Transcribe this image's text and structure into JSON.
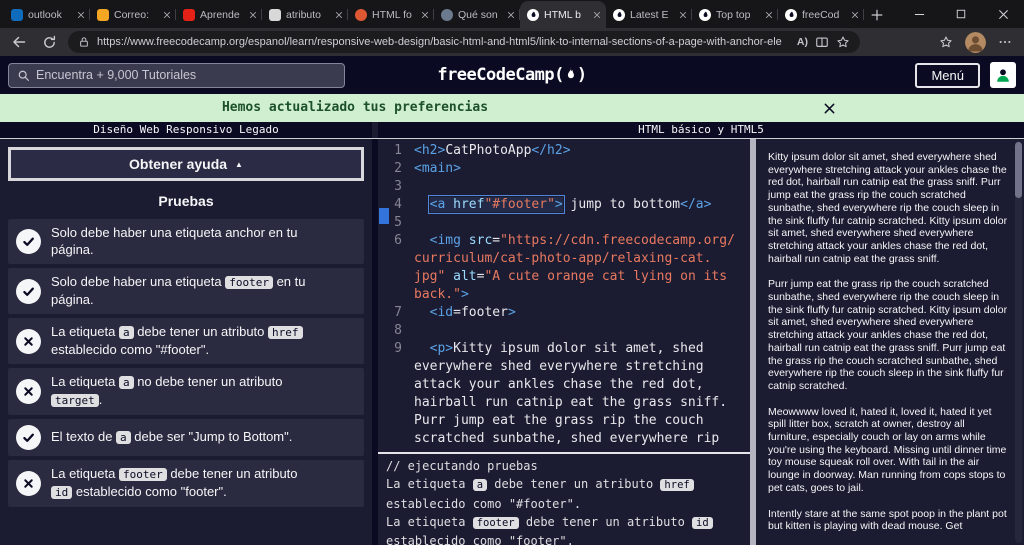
{
  "browser": {
    "tabs": [
      {
        "label": "outlook",
        "icon": "outlook",
        "color": "#0f6cbd",
        "shape": "square",
        "active": false
      },
      {
        "label": "Correo:",
        "icon": "mail",
        "color": "#f5a623",
        "shape": "square",
        "active": false
      },
      {
        "label": "Aprende",
        "icon": "video",
        "color": "#e62117",
        "shape": "square",
        "active": false
      },
      {
        "label": "atributo",
        "icon": "page",
        "color": "#d8d8d8",
        "shape": "square",
        "active": false
      },
      {
        "label": "HTML fo",
        "icon": "duckduckgo",
        "color": "#de5833",
        "shape": "circle",
        "active": false
      },
      {
        "label": "Qué son",
        "icon": "site",
        "color": "#6b7b8d",
        "shape": "circle",
        "active": false
      },
      {
        "label": "HTML b",
        "icon": "freecodecamp",
        "color": "#ffffff",
        "shape": "fcc",
        "active": true
      },
      {
        "label": "Latest E",
        "icon": "freecodecamp",
        "color": "#ffffff",
        "shape": "fcc",
        "active": false
      },
      {
        "label": "Top top",
        "icon": "freecodecamp",
        "color": "#ffffff",
        "shape": "fcc",
        "active": false
      },
      {
        "label": "freeCod",
        "icon": "freecodecamp",
        "color": "#ffffff",
        "shape": "fcc",
        "active": false
      }
    ],
    "url": "https://www.freecodecamp.org/espanol/learn/responsive-web-design/basic-html-and-html5/link-to-internal-sections-of-a-page-with-anchor-ele",
    "read_aloud_glyph": "A)"
  },
  "fcc_header": {
    "search_placeholder": "Encuentra + 9,000 Tutoriales",
    "logo_text": "freeCodeCamp",
    "logo_open": "(",
    "logo_close": ")",
    "menu_label": "Menú"
  },
  "banner": {
    "message": "Hemos actualizado tus preferencias"
  },
  "breadcrumbs": {
    "left": "Diseño Web Responsivo Legado",
    "right": "HTML básico y HTML5"
  },
  "left_panel": {
    "help_button": "Obtener ayuda",
    "help_button_caret": "▲",
    "tests_title": "Pruebas",
    "tests": [
      {
        "status": "pass",
        "segments": [
          {
            "c": "text",
            "s": "Solo debe haber una etiqueta anchor en tu página."
          }
        ]
      },
      {
        "status": "pass",
        "segments": [
          {
            "c": "text",
            "s": "Solo debe haber una etiqueta "
          },
          {
            "c": "code",
            "s": "footer"
          },
          {
            "c": "text",
            "s": " en tu página."
          }
        ]
      },
      {
        "status": "fail",
        "segments": [
          {
            "c": "text",
            "s": "La etiqueta "
          },
          {
            "c": "code",
            "s": "a"
          },
          {
            "c": "text",
            "s": " debe tener un atributo "
          },
          {
            "c": "code",
            "s": "href"
          },
          {
            "c": "text",
            "s": " establecido como \"#footer\"."
          }
        ]
      },
      {
        "status": "fail",
        "segments": [
          {
            "c": "text",
            "s": "La etiqueta "
          },
          {
            "c": "code",
            "s": "a"
          },
          {
            "c": "text",
            "s": " no debe tener un atributo "
          },
          {
            "c": "code",
            "s": "target"
          },
          {
            "c": "text",
            "s": "."
          }
        ]
      },
      {
        "status": "pass",
        "segments": [
          {
            "c": "text",
            "s": "El texto de "
          },
          {
            "c": "code",
            "s": "a"
          },
          {
            "c": "text",
            "s": " debe ser \"Jump to Bottom\"."
          }
        ]
      },
      {
        "status": "fail",
        "segments": [
          {
            "c": "text",
            "s": "La etiqueta "
          },
          {
            "c": "code",
            "s": "footer"
          },
          {
            "c": "text",
            "s": " debe tener un atributo "
          },
          {
            "c": "code",
            "s": "id"
          },
          {
            "c": "text",
            "s": " establecido como \"footer\"."
          }
        ]
      }
    ]
  },
  "editor": {
    "lines": [
      {
        "num": "1",
        "tokens": [
          {
            "c": "tg",
            "s": "<h2>"
          },
          {
            "c": "tx",
            "s": "CatPhotoApp"
          },
          {
            "c": "tg",
            "s": "</h2>"
          }
        ]
      },
      {
        "num": "2",
        "tokens": [
          {
            "c": "tg",
            "s": "<main>"
          }
        ]
      },
      {
        "num": "3",
        "tokens": []
      },
      {
        "num": "4",
        "tokens": [
          {
            "c": "tx",
            "s": "  "
          },
          {
            "box": [
              {
                "c": "tg",
                "s": "<a "
              },
              {
                "c": "at",
                "s": "href"
              },
              {
                "c": "st",
                "s": "\"#footer\""
              },
              {
                "c": "tg",
                "s": ">"
              }
            ]
          },
          {
            "c": "tx",
            "s": " jump to bottom"
          },
          {
            "c": "tg",
            "s": "</a>"
          }
        ]
      },
      {
        "num": "5",
        "marker": true,
        "tokens": []
      },
      {
        "num": "6",
        "tokens": [
          {
            "c": "tx",
            "s": "  "
          },
          {
            "c": "tg",
            "s": "<img "
          },
          {
            "c": "at",
            "s": "src"
          },
          {
            "c": "tx",
            "s": "="
          },
          {
            "c": "st",
            "s": "\"https://cdn.freecodecamp.org/"
          }
        ]
      },
      {
        "num": "",
        "tokens": [
          {
            "c": "st",
            "s": "curriculum/cat-photo-app/relaxing-cat."
          }
        ]
      },
      {
        "num": "",
        "tokens": [
          {
            "c": "st",
            "s": "jpg\""
          },
          {
            "c": "tx",
            "s": " "
          },
          {
            "c": "at",
            "s": "alt"
          },
          {
            "c": "tx",
            "s": "="
          },
          {
            "c": "st",
            "s": "\"A cute orange cat lying on its"
          }
        ]
      },
      {
        "num": "",
        "tokens": [
          {
            "c": "st",
            "s": "back.\""
          },
          {
            "c": "tg",
            "s": ">"
          }
        ]
      },
      {
        "num": "7",
        "tokens": [
          {
            "c": "tx",
            "s": "  "
          },
          {
            "c": "tg",
            "s": "<id"
          },
          {
            "c": "tx",
            "s": "="
          },
          {
            "c": "tx",
            "s": "footer"
          },
          {
            "c": "tg",
            "s": ">"
          }
        ]
      },
      {
        "num": "8",
        "tokens": []
      },
      {
        "num": "9",
        "tokens": [
          {
            "c": "tx",
            "s": "  "
          },
          {
            "c": "tg",
            "s": "<p>"
          },
          {
            "c": "tx",
            "s": "Kitty ipsum dolor sit amet, shed"
          }
        ]
      },
      {
        "num": "",
        "tokens": [
          {
            "c": "tx",
            "s": "everywhere shed everywhere stretching"
          }
        ]
      },
      {
        "num": "",
        "tokens": [
          {
            "c": "tx",
            "s": "attack your ankles chase the red dot,"
          }
        ]
      },
      {
        "num": "",
        "tokens": [
          {
            "c": "tx",
            "s": "hairball run catnip eat the grass sniff."
          }
        ]
      },
      {
        "num": "",
        "tokens": [
          {
            "c": "tx",
            "s": "Purr jump eat the grass rip the couch"
          }
        ]
      },
      {
        "num": "",
        "tokens": [
          {
            "c": "tx",
            "s": "scratched sunbathe, shed everywhere rip"
          }
        ]
      }
    ]
  },
  "console": {
    "lines": [
      {
        "segments": [
          {
            "c": "text",
            "s": "// ejecutando pruebas"
          }
        ]
      },
      {
        "segments": [
          {
            "c": "text",
            "s": "La etiqueta "
          },
          {
            "c": "code",
            "s": "a"
          },
          {
            "c": "text",
            "s": " debe tener un atributo "
          },
          {
            "c": "code",
            "s": "href"
          },
          {
            "c": "text",
            "s": " establecido como \"#footer\"."
          }
        ]
      },
      {
        "segments": [
          {
            "c": "text",
            "s": "La etiqueta "
          },
          {
            "c": "code",
            "s": "footer"
          },
          {
            "c": "text",
            "s": " debe tener un atributo "
          },
          {
            "c": "code",
            "s": "id"
          },
          {
            "c": "text",
            "s": " establecido como \"footer\"."
          }
        ]
      }
    ]
  },
  "preview": {
    "paragraphs": [
      "Kitty ipsum dolor sit amet, shed everywhere shed everywhere stretching attack your ankles chase the red dot, hairball run catnip eat the grass sniff. Purr jump eat the grass rip the couch scratched sunbathe, shed everywhere rip the couch sleep in the sink fluffy fur catnip scratched. Kitty ipsum dolor sit amet, shed everywhere shed everywhere stretching attack your ankles chase the red dot, hairball run catnip eat the grass sniff.",
      "Purr jump eat the grass rip the couch scratched sunbathe, shed everywhere rip the couch sleep in the sink fluffy fur catnip scratched. Kitty ipsum dolor sit amet, shed everywhere shed everywhere stretching attack your ankles chase the red dot, hairball run catnip eat the grass sniff. Purr jump eat the grass rip the couch scratched sunbathe, shed everywhere rip the couch sleep in the sink fluffy fur catnip scratched.",
      "Meowwww loved it, hated it, loved it, hated it yet spill litter box, scratch at owner, destroy all furniture, especially couch or lay on arms while you're using the keyboard. Missing until dinner time toy mouse squeak roll over. With tail in the air lounge in doorway. Man running from cops stops to pet cats, goes to jail.",
      "Intently stare at the same spot poop in the plant pot but kitten is playing with dead mouse. Get"
    ]
  }
}
